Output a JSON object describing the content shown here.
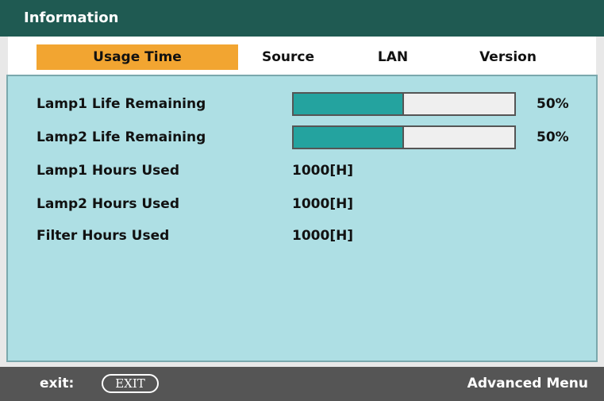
{
  "window": {
    "title": "Information"
  },
  "tabs": [
    {
      "label": "Usage Time",
      "active": true
    },
    {
      "label": "Source",
      "active": false
    },
    {
      "label": "LAN",
      "active": false
    },
    {
      "label": "Version",
      "active": false
    }
  ],
  "usage": {
    "lamp1_life": {
      "label": "Lamp1 Life Remaining",
      "percent_text": "50%",
      "fraction": 0.5
    },
    "lamp2_life": {
      "label": "Lamp2 Life Remaining",
      "percent_text": "50%",
      "fraction": 0.5
    },
    "lamp1_hours": {
      "label": "Lamp1 Hours Used",
      "value": "1000[H]"
    },
    "lamp2_hours": {
      "label": "Lamp2 Hours Used",
      "value": "1000[H]"
    },
    "filter_hours": {
      "label": "Filter Hours Used",
      "value": "1000[H]"
    }
  },
  "statusbar": {
    "exit_label": "exit:",
    "exit_key": "EXIT",
    "advanced_menu": "Advanced Menu"
  },
  "colors": {
    "title_bg": "#1f5a52",
    "active_tab": "#f2a531",
    "panel_bg": "#aedfe4",
    "bar_fill": "#24a39f",
    "status_bg": "#555555"
  }
}
